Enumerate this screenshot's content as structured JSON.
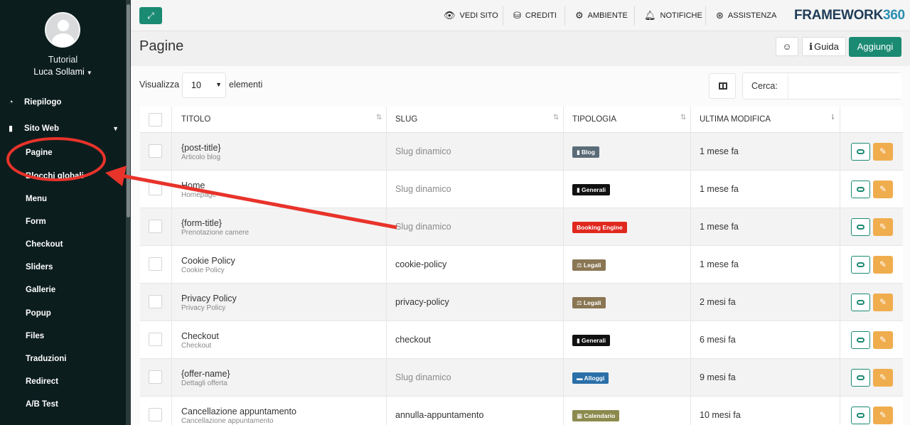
{
  "sidebar": {
    "user_org": "Tutorial",
    "user_name": "Luca Sollami",
    "nav": [
      {
        "label": "Riepilogo",
        "icon": "dashboard-icon"
      },
      {
        "label": "Sito Web",
        "icon": "file-icon",
        "expanded": true
      }
    ],
    "sub_items": [
      "Pagine",
      "Blocchi globali",
      "Menu",
      "Form",
      "Checkout",
      "Sliders",
      "Gallerie",
      "Popup",
      "Files",
      "Traduzioni",
      "Redirect",
      "A/B Test"
    ]
  },
  "topbar": {
    "links": [
      {
        "label": "VEDI SITO",
        "icon": "eye-icon"
      },
      {
        "label": "CREDITI",
        "icon": "coins-icon"
      },
      {
        "label": "AMBIENTE",
        "icon": "cubes-icon"
      },
      {
        "label": "NOTIFICHE",
        "icon": "bell-icon"
      },
      {
        "label": "ASSISTENZA",
        "icon": "lifebuoy-icon"
      }
    ],
    "brand": "FRAMEWORK",
    "brand_num": "360"
  },
  "page": {
    "title": "Pagine",
    "guida_label": "Guida",
    "add_label": "Aggiungi"
  },
  "table_controls": {
    "show_label": "Visualizza",
    "page_size": "10",
    "show_suffix": "elementi",
    "search_label": "Cerca:",
    "search_value": ""
  },
  "table": {
    "columns": [
      "TITOLO",
      "SLUG",
      "TIPOLOGIA",
      "ULTIMA MODIFICA"
    ],
    "rows": [
      {
        "title": "{post-title}",
        "subtitle": "Articolo blog",
        "slug": "Slug dinamico",
        "slug_dynamic": true,
        "type": "Blog",
        "type_color": "#5b6c79",
        "modified": "1 mese fa"
      },
      {
        "title": "Home",
        "subtitle": "Homepage",
        "slug": "Slug dinamico",
        "slug_dynamic": true,
        "type": "Generali",
        "type_color": "#111111",
        "modified": "1 mese fa"
      },
      {
        "title": "{form-title}",
        "subtitle": "Prenotazione camere",
        "slug": "Slug dinamico",
        "slug_dynamic": true,
        "type": "Booking Engine",
        "type_color": "#e0281f",
        "modified": "1 mese fa"
      },
      {
        "title": "Cookie Policy",
        "subtitle": "Cookie Policy",
        "slug": "cookie-policy",
        "slug_dynamic": false,
        "type": "Legali",
        "type_color": "#8a7653",
        "modified": "1 mese fa"
      },
      {
        "title": "Privacy Policy",
        "subtitle": "Privacy Policy",
        "slug": "privacy-policy",
        "slug_dynamic": false,
        "type": "Legali",
        "type_color": "#8a7653",
        "modified": "2 mesi fa"
      },
      {
        "title": "Checkout",
        "subtitle": "Checkout",
        "slug": "checkout",
        "slug_dynamic": false,
        "type": "Generali",
        "type_color": "#111111",
        "modified": "6 mesi fa"
      },
      {
        "title": "{offer-name}",
        "subtitle": "Dettagli offerta",
        "slug": "Slug dinamico",
        "slug_dynamic": true,
        "type": "Alloggi",
        "type_color": "#2a6fa8",
        "modified": "9 mesi fa"
      },
      {
        "title": "Cancellazione appuntamento",
        "subtitle": "Cancellazione appuntamento",
        "slug": "annulla-appuntamento",
        "slug_dynamic": false,
        "type": "Calendario",
        "type_color": "#8d8a4e",
        "modified": "10 mesi fa"
      }
    ]
  },
  "colors": {
    "accent": "#1b8a73",
    "sidebar_bg": "#0c1d1e",
    "edit_button": "#f0ad4e",
    "annotation": "#e8332a"
  }
}
